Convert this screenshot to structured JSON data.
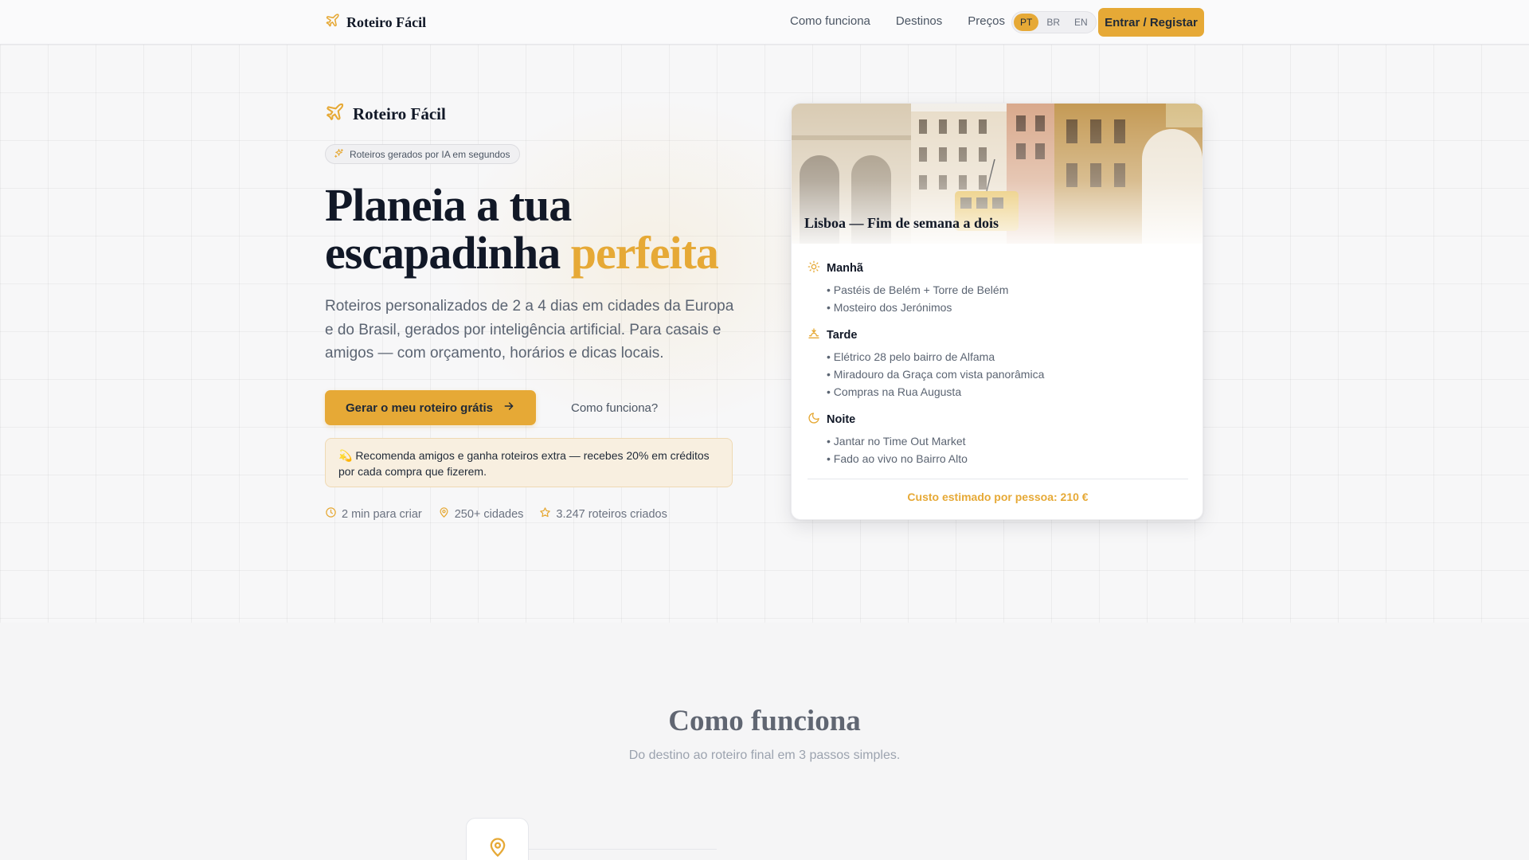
{
  "nav": {
    "brand": "Roteiro Fácil",
    "links": [
      "Como funciona",
      "Destinos",
      "Preços"
    ],
    "languages": [
      "PT",
      "BR",
      "EN"
    ],
    "active_language": "PT",
    "login_label": "Entrar / Registar"
  },
  "hero": {
    "brand": "Roteiro Fácil",
    "badge": "Roteiros gerados por IA em segundos",
    "headline_part1": "Planeia a tua escapadinha ",
    "headline_accent": "perfeita",
    "subtext": "Roteiros personalizados de 2 a 4 dias em cidades da Europa e do Brasil, gerados por inteligência artificial. Para casais e amigos — com orçamento, horários e dicas locais.",
    "cta_label": "Gerar o meu roteiro grátis",
    "secondary_link": "Como funciona?",
    "referral": "💫 Recomenda amigos e ganha roteiros extra — recebes 20% em créditos por cada compra que fizerem.",
    "stats": [
      "2 min para criar",
      "250+ cidades",
      "3.247 roteiros criados"
    ]
  },
  "card": {
    "title": "Lisboa — Fim de semana a dois",
    "sections": [
      {
        "title": "Manhã",
        "icon": "sun-icon",
        "items": [
          "• Pastéis de Belém + Torre de Belém",
          "• Mosteiro dos Jerónimos"
        ]
      },
      {
        "title": "Tarde",
        "icon": "sunset-icon",
        "items": [
          "• Elétrico 28 pelo bairro de Alfama",
          "• Miradouro da Graça com vista panorâmica",
          "• Compras na Rua Augusta"
        ]
      },
      {
        "title": "Noite",
        "icon": "moon-icon",
        "items": [
          "• Jantar no Time Out Market",
          "• Fado ao vivo no Bairro Alto"
        ]
      }
    ],
    "cost": "Custo estimado por pessoa: 210 €"
  },
  "how": {
    "title": "Como funciona",
    "subtitle": "Do destino ao roteiro final em 3 passos simples."
  },
  "colors": {
    "accent": "#e6a936",
    "heading": "#111827",
    "muted": "#5b6472"
  }
}
